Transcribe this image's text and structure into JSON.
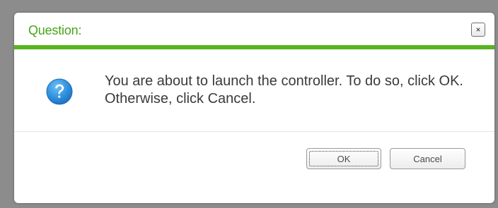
{
  "dialog": {
    "title": "Question:",
    "close_icon": "close-icon",
    "message": "You are about to launch the controller. To do so, click OK. Otherwise, click Cancel.",
    "question_icon": "question-mark-icon",
    "buttons": {
      "ok_label": "OK",
      "cancel_label": "Cancel"
    }
  },
  "colors": {
    "title": "#4aa319",
    "accent_rule": "#57b51e",
    "icon_blue": "#2f8fdc",
    "overlay": "#8c8c8c"
  }
}
